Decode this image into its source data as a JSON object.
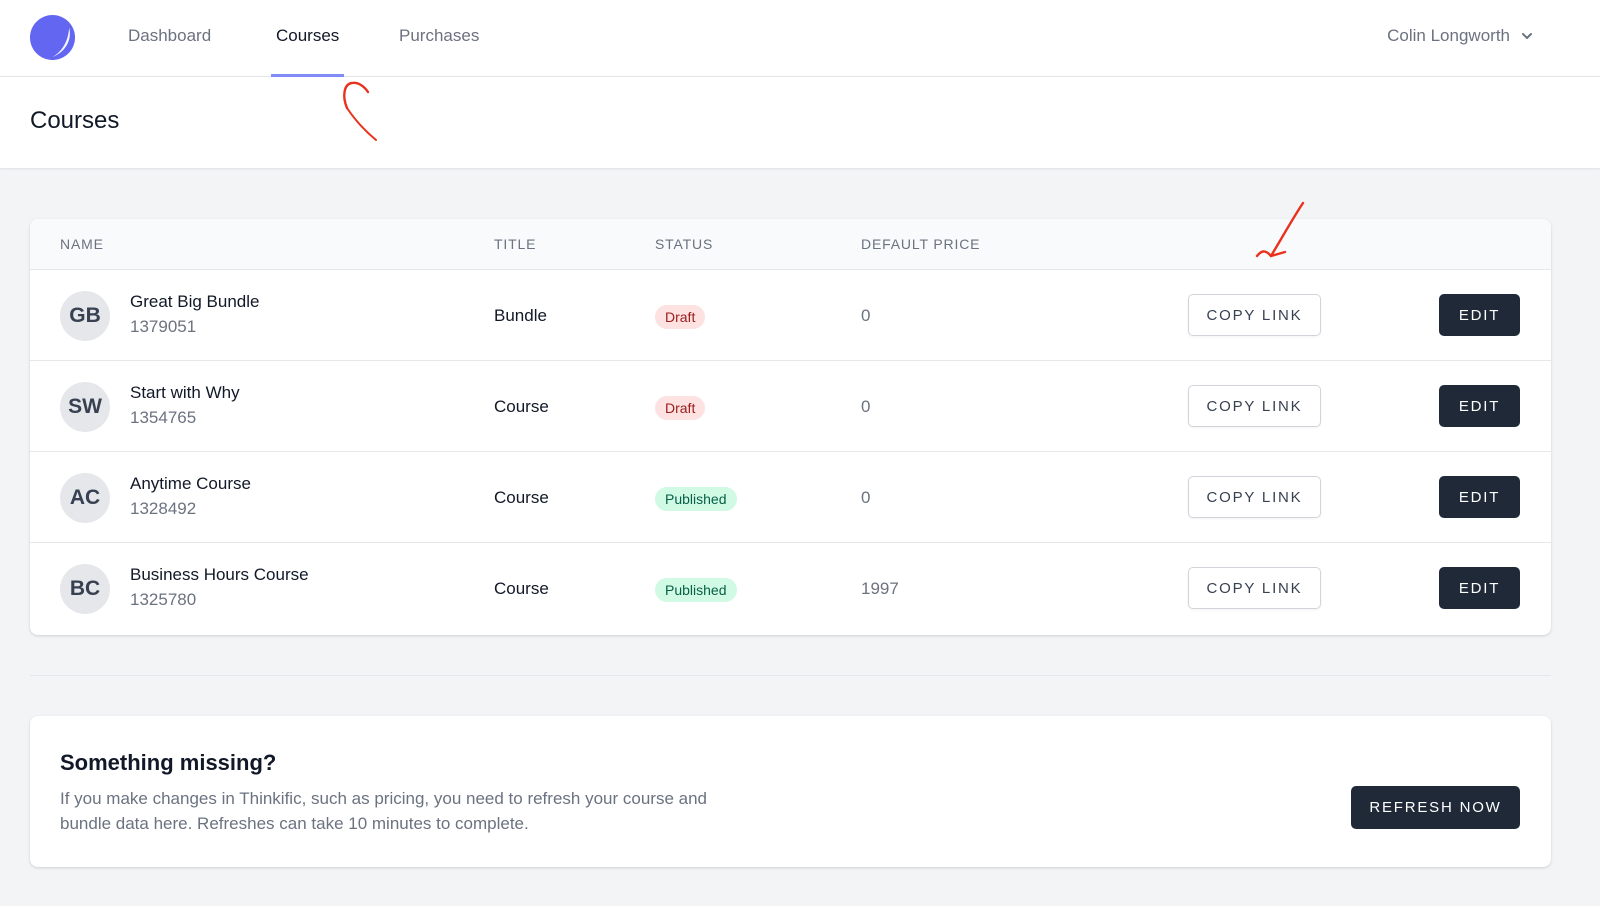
{
  "nav": {
    "items": [
      {
        "label": "Dashboard"
      },
      {
        "label": "Courses"
      },
      {
        "label": "Purchases"
      }
    ],
    "user_name": "Colin Longworth"
  },
  "page": {
    "title": "Courses"
  },
  "table": {
    "headers": [
      "NAME",
      "TITLE",
      "STATUS",
      "DEFAULT PRICE"
    ],
    "rows": [
      {
        "initials": "GB",
        "name": "Great Big Bundle",
        "id": "1379051",
        "title": "Bundle",
        "status": "Draft",
        "price": "0",
        "copy_label": "COPY LINK",
        "edit_label": "EDIT"
      },
      {
        "initials": "SW",
        "name": "Start with Why",
        "id": "1354765",
        "title": "Course",
        "status": "Draft",
        "price": "0",
        "copy_label": "COPY LINK",
        "edit_label": "EDIT"
      },
      {
        "initials": "AC",
        "name": "Anytime Course",
        "id": "1328492",
        "title": "Course",
        "status": "Published",
        "price": "0",
        "copy_label": "COPY LINK",
        "edit_label": "EDIT"
      },
      {
        "initials": "BC",
        "name": "Business Hours Course",
        "id": "1325780",
        "title": "Course",
        "status": "Published",
        "price": "1997",
        "copy_label": "COPY LINK",
        "edit_label": "EDIT"
      }
    ]
  },
  "missing": {
    "title": "Something missing?",
    "text": "If you make changes in Thinkific, such as pricing, you need to refresh your course and bundle data here. Refreshes can take 10 minutes to complete.",
    "button_label": "REFRESH NOW"
  },
  "colors": {
    "accent": "#818cf8",
    "logo": "#6366f1",
    "dark_button": "#1f2937",
    "draft_bg": "#fee2e2",
    "draft_text": "#991b1b",
    "published_bg": "#d1fae5",
    "published_text": "#065f46",
    "annotation": "#e8321e"
  },
  "icons": {
    "logo": "app-logo-icon",
    "user_dropdown": "chevron-down-icon"
  }
}
